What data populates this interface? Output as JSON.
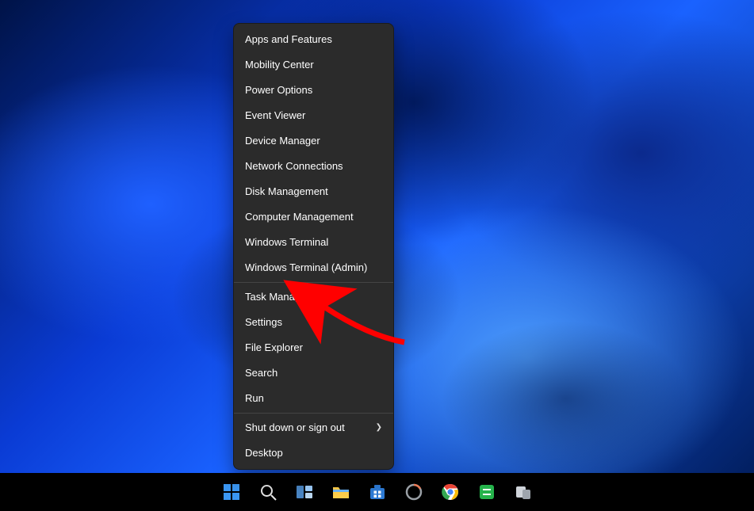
{
  "context_menu": {
    "sections": [
      [
        "Apps and Features",
        "Mobility Center",
        "Power Options",
        "Event Viewer",
        "Device Manager",
        "Network Connections",
        "Disk Management",
        "Computer Management",
        "Windows Terminal",
        "Windows Terminal (Admin)"
      ],
      [
        "Task Manager",
        "Settings",
        "File Explorer",
        "Search",
        "Run"
      ],
      [
        {
          "label": "Shut down or sign out",
          "submenu": true
        },
        "Desktop"
      ]
    ],
    "highlighted_item": "Task Manager"
  },
  "taskbar": {
    "icons": [
      {
        "name": "start-icon"
      },
      {
        "name": "search-icon"
      },
      {
        "name": "task-view-icon"
      },
      {
        "name": "file-explorer-icon"
      },
      {
        "name": "microsoft-store-icon"
      },
      {
        "name": "app-generic-1-icon"
      },
      {
        "name": "chrome-icon"
      },
      {
        "name": "app-generic-2-icon"
      },
      {
        "name": "app-generic-3-icon"
      }
    ]
  },
  "annotation": {
    "type": "arrow",
    "color": "#ff0000",
    "points_at": "Task Manager"
  }
}
